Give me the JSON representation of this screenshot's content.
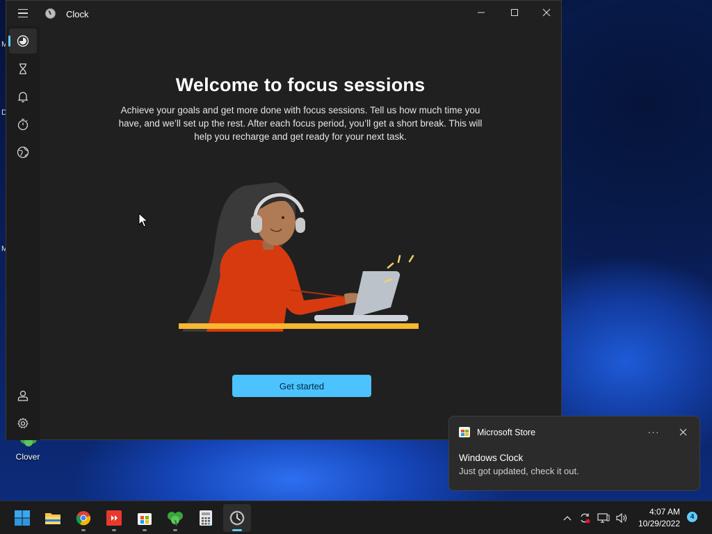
{
  "desktop": {
    "icon_label": "Clover",
    "edge_letters": [
      "M",
      "D",
      "M"
    ]
  },
  "window": {
    "title": "Clock",
    "nav": [
      {
        "name": "focus-sessions",
        "icon": "focus-icon",
        "active": true
      },
      {
        "name": "timer",
        "icon": "hourglass-icon"
      },
      {
        "name": "alarm",
        "icon": "bell-icon"
      },
      {
        "name": "stopwatch",
        "icon": "stopwatch-icon"
      },
      {
        "name": "world-clock",
        "icon": "globe-icon"
      }
    ],
    "nav_bottom": [
      {
        "name": "account",
        "icon": "person-icon"
      },
      {
        "name": "settings",
        "icon": "gear-icon"
      }
    ]
  },
  "main": {
    "headline": "Welcome to focus sessions",
    "description": "Achieve your goals and get more done with focus sessions. Tell us how much time you have, and we’ll set up the rest. After each focus period, you’ll get a short break. This will help you recharge and get ready for your next task.",
    "cta_label": "Get started"
  },
  "toast": {
    "source": "Microsoft Store",
    "title": "Windows Clock",
    "body": "Just got updated, check it out.",
    "more_label": "···"
  },
  "taskbar": {
    "apps": [
      "start",
      "file-explorer",
      "chrome",
      "anydesk",
      "microsoft-store",
      "clover",
      "calculator",
      "clock"
    ],
    "time": "4:07 AM",
    "date": "10/29/2022",
    "notification_count": "4"
  },
  "colors": {
    "accent": "#4cc2ff",
    "window_bg": "#202020",
    "nav_bg": "#1c1c1c"
  }
}
